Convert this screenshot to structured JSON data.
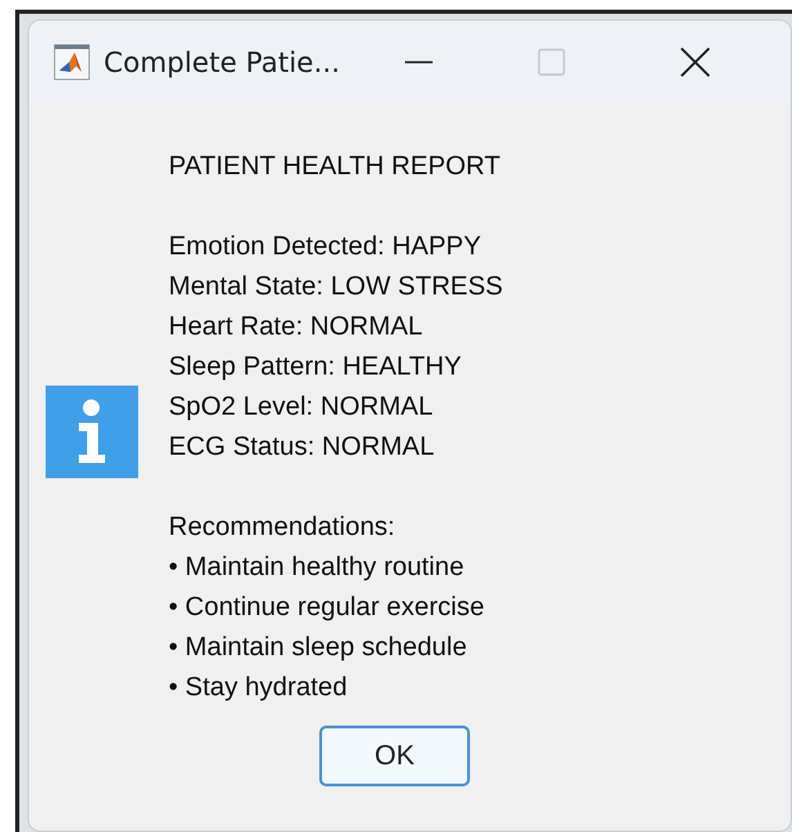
{
  "window": {
    "title": "Complete Patie..."
  },
  "message": {
    "heading": "PATIENT HEALTH REPORT",
    "status_lines": [
      "Emotion Detected: HAPPY",
      "Mental State: LOW STRESS",
      "Heart Rate: NORMAL",
      "Sleep Pattern: HEALTHY",
      "SpO2 Level: NORMAL",
      "ECG Status: NORMAL"
    ],
    "recommendations_heading": "Recommendations:",
    "recommendations": [
      "• Maintain healthy routine",
      "• Continue regular exercise",
      "• Maintain sleep schedule",
      "• Stay hydrated"
    ]
  },
  "buttons": [
    "OK"
  ]
}
